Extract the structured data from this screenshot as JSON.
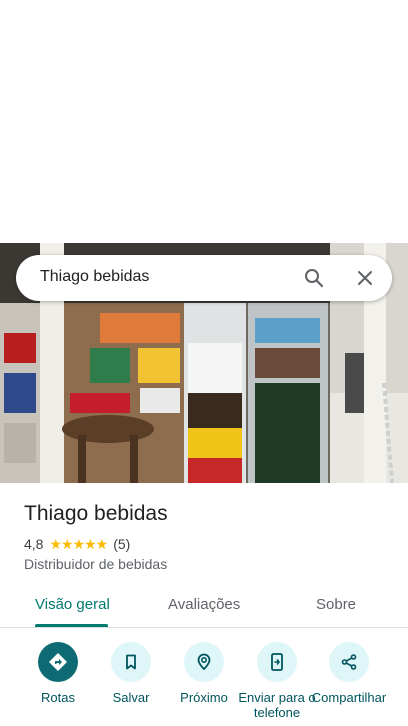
{
  "search": {
    "query": "Thiago bebidas"
  },
  "place": {
    "name": "Thiago bebidas",
    "rating": "4,8",
    "stars": "★★★★★",
    "reviews_count": "(5)",
    "category": "Distribuidor de bebidas"
  },
  "tabs": [
    {
      "label": "Visão geral",
      "active": true
    },
    {
      "label": "Avaliações",
      "active": false
    },
    {
      "label": "Sobre",
      "active": false
    }
  ],
  "actions": [
    {
      "label": "Rotas",
      "icon": "directions-icon"
    },
    {
      "label": "Salvar",
      "icon": "bookmark-icon"
    },
    {
      "label": "Próximo",
      "icon": "nearby-icon"
    },
    {
      "label": "Enviar para o telefone",
      "icon": "send-to-phone-icon"
    },
    {
      "label": "Compartilhar",
      "icon": "share-icon"
    }
  ],
  "colors": {
    "accent": "#01796f",
    "action_bg": "#def6f8",
    "primary_action": "#0f6b73",
    "star": "#fbbc04"
  }
}
